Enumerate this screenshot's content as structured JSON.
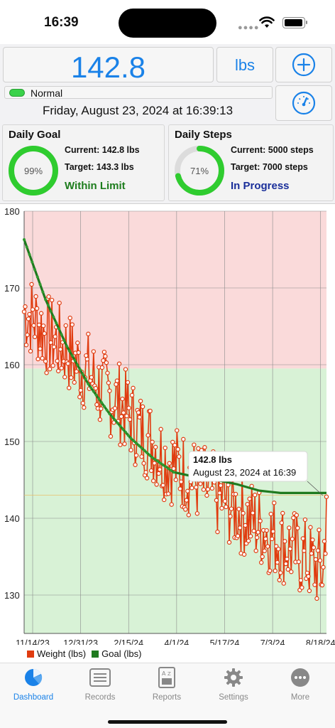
{
  "status_bar": {
    "time": "16:39"
  },
  "header": {
    "weight": "142.8",
    "unit": "lbs",
    "state": "Normal",
    "datetime": "Friday, August 23, 2024 at 16:39:13"
  },
  "cards": {
    "goal": {
      "title": "Daily Goal",
      "percent_label": "99%",
      "percent": 0.99,
      "current": "Current: 142.8 lbs",
      "target": "Target: 143.3 lbs",
      "status": "Within Limit",
      "status_color": "#1d7d1d"
    },
    "steps": {
      "title": "Daily Steps",
      "percent_label": "71%",
      "percent": 0.71,
      "current": "Current: 5000 steps",
      "target": "Target: 7000 steps",
      "status": "In Progress",
      "status_color": "#1a2f9a"
    }
  },
  "colors": {
    "accent": "#1a82e8",
    "weight_series": "#e03c10",
    "goal_series": "#1f7a1f",
    "ring": "#2fcc2f",
    "over_zone": "#fadada",
    "ok_zone": "#d8f2d6"
  },
  "chart_data": {
    "type": "line",
    "y_ticks": [
      "180",
      "170",
      "160",
      "150",
      "140",
      "130"
    ],
    "ylim": [
      125,
      180
    ],
    "threshold": 159.5,
    "x_ticks": [
      "11/14/23",
      "12/31/23",
      "2/15/24",
      "4/1/24",
      "5/17/24",
      "7/3/24",
      "8/18/24"
    ],
    "grid": true,
    "legend": [
      "Weight (lbs)",
      "Goal (lbs)"
    ],
    "tooltip": {
      "title": "142.8 lbs",
      "subtitle": "August 23, 2024 at 16:39"
    },
    "series": [
      {
        "name": "Weight (lbs)",
        "x": [
          0,
          10,
          20,
          30,
          40,
          50,
          60,
          70,
          80,
          90,
          100,
          110,
          120,
          130,
          140,
          150,
          160,
          170,
          180,
          190,
          200,
          210,
          220,
          230,
          240,
          250,
          260,
          270,
          280,
          283
        ],
        "values": [
          167,
          166,
          164,
          163,
          162,
          160,
          159,
          157,
          156,
          155,
          153,
          151,
          150,
          148,
          147,
          146,
          145,
          144,
          143,
          142,
          141,
          140,
          139,
          138,
          137,
          136,
          135,
          134,
          133,
          142.8
        ]
      },
      {
        "name": "Goal (lbs)",
        "x": [
          0,
          20,
          40,
          60,
          80,
          100,
          120,
          140,
          160,
          180,
          200,
          220,
          240,
          260,
          283
        ],
        "values": [
          176.3,
          168.5,
          162.4,
          157.5,
          153.6,
          150.4,
          147.9,
          146.0,
          145.4,
          145.0,
          144.4,
          143.6,
          143.3,
          143.3,
          143.3
        ]
      }
    ]
  },
  "tabs": [
    {
      "label": "Dashboard",
      "active": true
    },
    {
      "label": "Records"
    },
    {
      "label": "Reports"
    },
    {
      "label": "Settings"
    },
    {
      "label": "More"
    }
  ]
}
